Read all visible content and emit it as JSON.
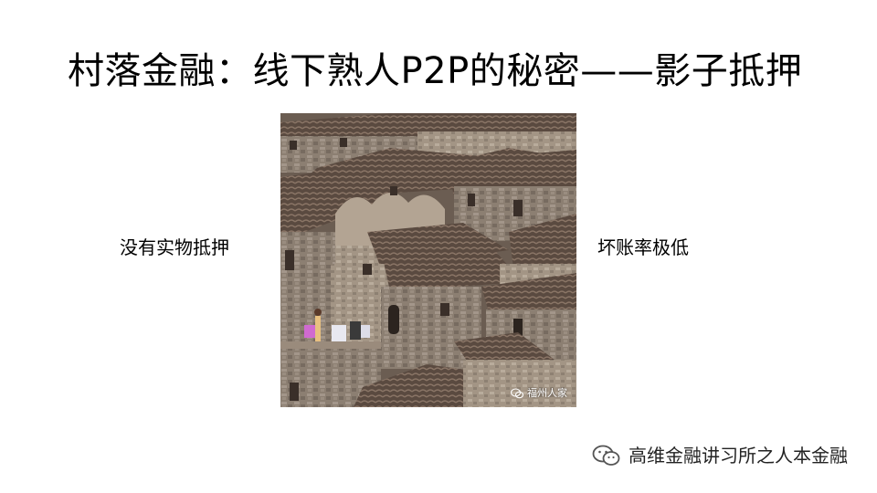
{
  "slide": {
    "title": "村落金融：线下熟人P2P的秘密——影子抵押",
    "left_label": "没有实物抵押",
    "right_label": "坏账率极低"
  },
  "photo": {
    "subject": "stone village houses with tiled roofs",
    "watermark_text": "福州人家"
  },
  "watermark": {
    "text": "高维金融讲习所之人本金融",
    "icon": "wechat-icon"
  }
}
